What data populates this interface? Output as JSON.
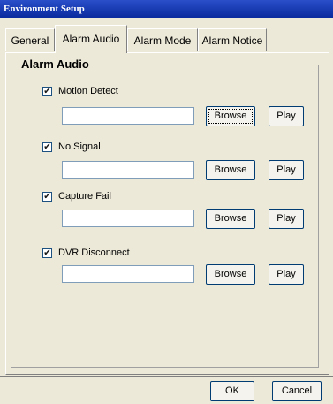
{
  "window": {
    "title": "Environment Setup"
  },
  "tabs": [
    {
      "label": "General"
    },
    {
      "label": "Alarm Audio"
    },
    {
      "label": "Alarm Mode"
    },
    {
      "label": "Alarm Notice"
    }
  ],
  "group": {
    "title": "Alarm Audio"
  },
  "alarms": [
    {
      "label": "Motion Detect",
      "checked": true,
      "checkmark": "✔",
      "path": "",
      "browse": "Browse",
      "play": "Play"
    },
    {
      "label": "No Signal",
      "checked": true,
      "checkmark": "✔",
      "path": "",
      "browse": "Browse",
      "play": "Play"
    },
    {
      "label": "Capture Fail",
      "checked": true,
      "checkmark": "✔",
      "path": "",
      "browse": "Browse",
      "play": "Play"
    },
    {
      "label": "DVR Disconnect",
      "checked": true,
      "checkmark": "✔",
      "path": "",
      "browse": "Browse",
      "play": "Play"
    }
  ],
  "footer": {
    "ok": "OK",
    "cancel": "Cancel"
  }
}
